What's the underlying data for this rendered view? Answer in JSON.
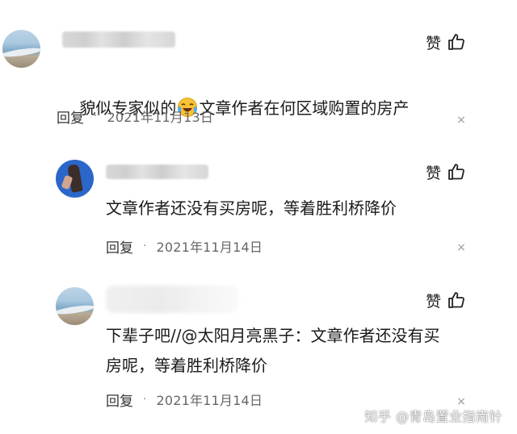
{
  "comments": [
    {
      "like_label": "赞",
      "text_before_emoji": "貌似专家似的",
      "text_after_emoji": "文章作者在何区域购置的房产",
      "reply_label": "回复",
      "separator": "·",
      "date": "2021年11月13日",
      "avatar_icon": "beach-avatar",
      "emoji_icon": "laughing-crying-emoji"
    },
    {
      "like_label": "赞",
      "text": "文章作者还没有买房呢，等着胜利桥降价",
      "reply_label": "回复",
      "separator": "·",
      "date": "2021年11月14日",
      "avatar_icon": "person-avatar"
    },
    {
      "like_label": "赞",
      "text": "下辈子吧//@太阳月亮黑子：文章作者还没有买\n房呢，等着胜利桥降价",
      "reply_label": "回复",
      "separator": "·",
      "date": "2021年11月14日",
      "avatar_icon": "beach-avatar"
    }
  ],
  "watermark": "知乎 @青岛置业指南针",
  "colors": {
    "text": "#1a1a1a",
    "meta": "#666666",
    "close": "#9a9a9a"
  }
}
